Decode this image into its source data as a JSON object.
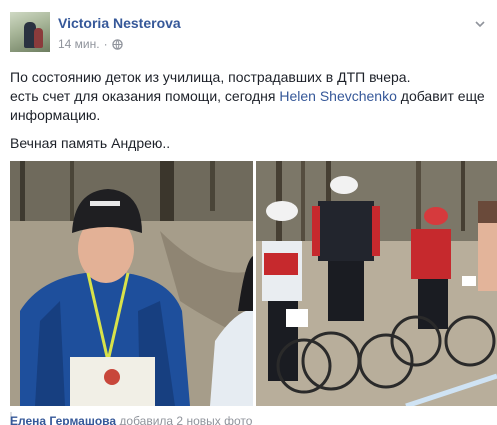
{
  "post": {
    "author": "Victoria Nesterova",
    "time": "14 мин.",
    "separator": "·",
    "privacy_icon": "globe-icon",
    "menu_icon": "chevron-down-icon",
    "text_line1": "По состоянию деток из училища, пострадавших в ДТП вчера.",
    "text_line2_before": "есть счет для оказания помощи, сегодня ",
    "mention": "Helen Shevchenko",
    "text_line2_after": " добавит еще информацию.",
    "text_line3": "Вечная память Андрею.."
  },
  "photos": [
    {
      "description_icon": "photo-boy-with-medal"
    },
    {
      "description_icon": "photo-cyclists-race"
    }
  ],
  "footer": {
    "name": "Елена Гермашова",
    "action": " добавила 2 новых фото"
  },
  "colors": {
    "link": "#365899",
    "meta": "#90949c",
    "text": "#1d2129"
  }
}
